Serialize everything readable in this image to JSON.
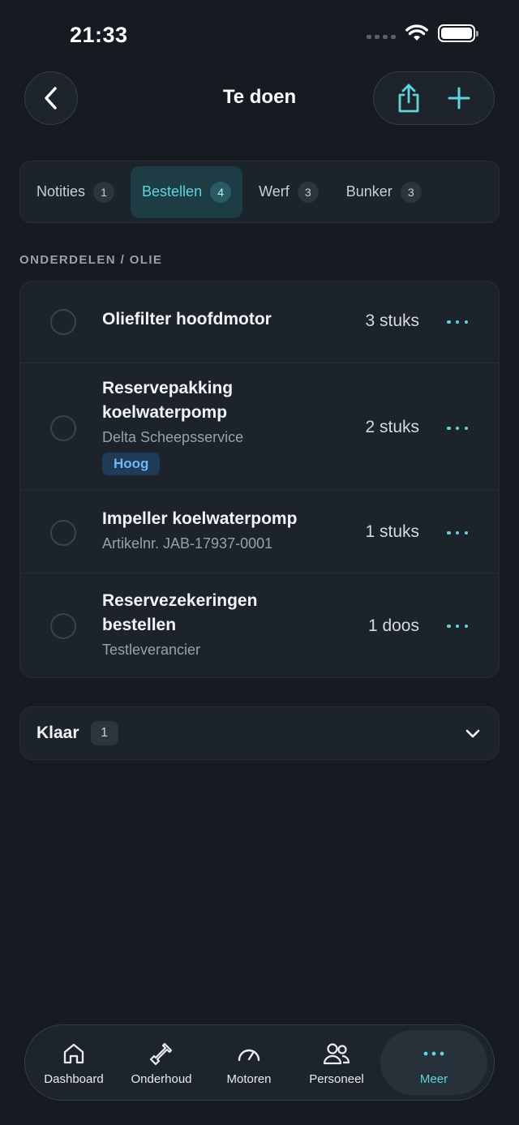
{
  "status_bar": {
    "time": "21:33"
  },
  "header": {
    "title": "Te doen",
    "back_icon": "chevron-left-icon",
    "share_icon": "share-icon",
    "add_icon": "plus-icon"
  },
  "tabs": [
    {
      "label": "Notities",
      "count": "1",
      "active": false
    },
    {
      "label": "Bestellen",
      "count": "4",
      "active": true
    },
    {
      "label": "Werf",
      "count": "3",
      "active": false
    },
    {
      "label": "Bunker",
      "count": "3",
      "active": false
    }
  ],
  "section": {
    "label": "ONDERDELEN / OLIE"
  },
  "items": [
    {
      "title": "Oliefilter hoofdmotor",
      "subtitle": "",
      "badge": "",
      "qty": "3 stuks"
    },
    {
      "title": "Reservepakking koelwaterpomp",
      "subtitle": "Delta Scheepsservice",
      "badge": "Hoog",
      "qty": "2 stuks"
    },
    {
      "title": "Impeller koelwaterpomp",
      "subtitle": "Artikelnr. JAB-17937-0001",
      "badge": "",
      "qty": "1 stuks"
    },
    {
      "title": "Reservezekeringen bestellen",
      "subtitle": "Testleverancier",
      "badge": "",
      "qty": "1 doos"
    }
  ],
  "done": {
    "label": "Klaar",
    "count": "1"
  },
  "nav": [
    {
      "label": "Dashboard",
      "icon": "home-icon",
      "active": false
    },
    {
      "label": "Onderhoud",
      "icon": "wrench-icon",
      "active": false
    },
    {
      "label": "Motoren",
      "icon": "gauge-icon",
      "active": false
    },
    {
      "label": "Personeel",
      "icon": "people-icon",
      "active": false
    },
    {
      "label": "Meer",
      "icon": "more-icon",
      "active": true
    }
  ],
  "colors": {
    "accent": "#5fd4dc",
    "background": "#161b22",
    "badge_high": "#72b6f0"
  }
}
